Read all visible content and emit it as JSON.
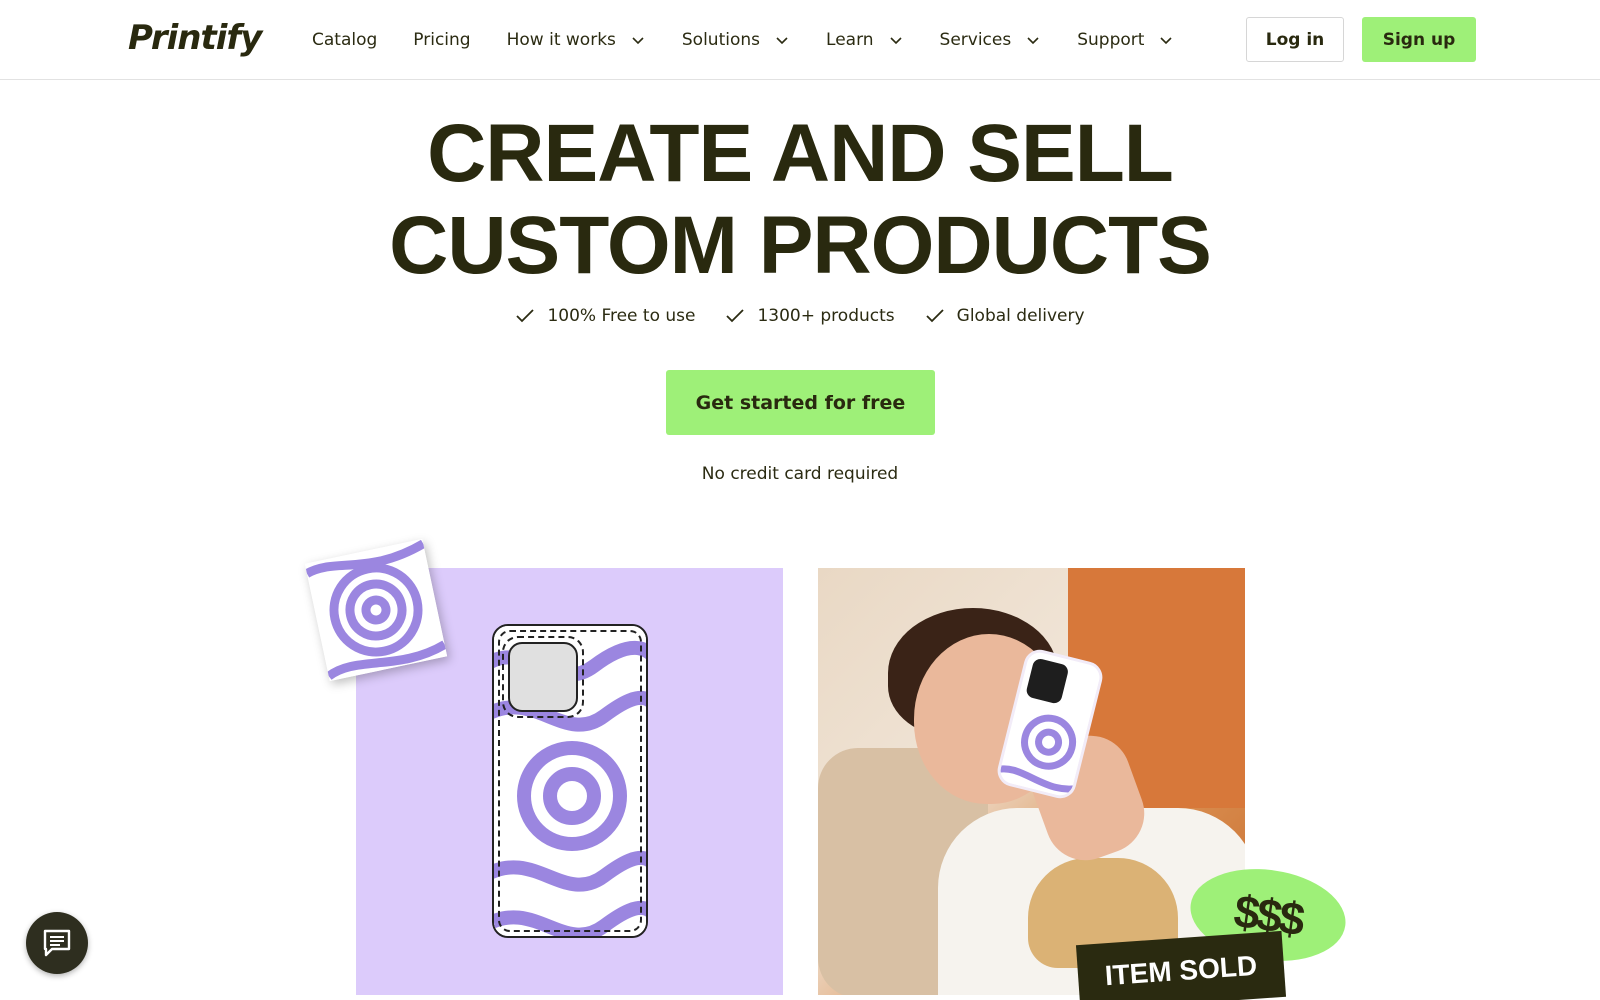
{
  "header": {
    "logo": "Printify",
    "nav": [
      {
        "label": "Catalog",
        "has_dropdown": false
      },
      {
        "label": "Pricing",
        "has_dropdown": false
      },
      {
        "label": "How it works",
        "has_dropdown": true
      },
      {
        "label": "Solutions",
        "has_dropdown": true
      },
      {
        "label": "Learn",
        "has_dropdown": true
      },
      {
        "label": "Services",
        "has_dropdown": true
      },
      {
        "label": "Support",
        "has_dropdown": true
      }
    ],
    "login_label": "Log in",
    "signup_label": "Sign up"
  },
  "hero": {
    "title_line1": "CREATE AND SELL",
    "title_line2": "CUSTOM PRODUCTS",
    "features": [
      "100% Free to use",
      "1300+ products",
      "Global delivery"
    ],
    "cta_label": "Get started for free",
    "note": "No credit card required"
  },
  "images": {
    "item_sold_label": "ITEM SOLD",
    "money_label": "$$$"
  },
  "colors": {
    "accent_green": "#9ef078",
    "dark_text": "#29290f",
    "lavender": "#dccbfb",
    "purple": "#9b86e0"
  },
  "icons": {
    "check": "check-icon",
    "chevron": "chevron-down-icon",
    "chat": "chat-icon"
  }
}
